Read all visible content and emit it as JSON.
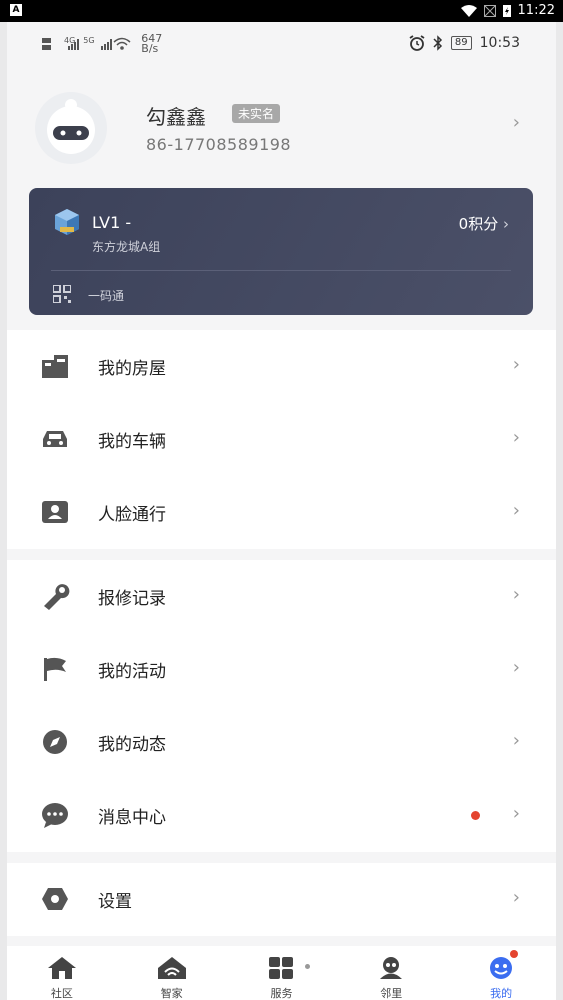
{
  "system_bar": {
    "app_icon_letter": "A",
    "time": "11:22"
  },
  "phone_status": {
    "net_speed": "647",
    "net_unit": "B/s",
    "network_4g": "4G",
    "network_5g": "5G",
    "battery": "89",
    "time": "10:53"
  },
  "profile": {
    "name": "勾鑫鑫",
    "badge": "未实名",
    "phone": "86-17708589198"
  },
  "member_card": {
    "level": "LV1 -",
    "org": "东方龙城A组",
    "points": "0积分",
    "qr_label": "一码通"
  },
  "menu_group1": [
    {
      "icon": "building-icon",
      "label": "我的房屋"
    },
    {
      "icon": "car-icon",
      "label": "我的车辆"
    },
    {
      "icon": "face-id-icon",
      "label": "人脸通行"
    }
  ],
  "menu_group2": [
    {
      "icon": "wrench-icon",
      "label": "报修记录"
    },
    {
      "icon": "flag-icon",
      "label": "我的活动"
    },
    {
      "icon": "compass-icon",
      "label": "我的动态"
    },
    {
      "icon": "chat-icon",
      "label": "消息中心"
    }
  ],
  "menu_group3": [
    {
      "icon": "settings-icon",
      "label": "设置"
    }
  ],
  "tabs": [
    {
      "icon": "home-icon",
      "label": "社区"
    },
    {
      "icon": "smart-home-icon",
      "label": "智家"
    },
    {
      "icon": "services-grid-icon",
      "label": "服务"
    },
    {
      "icon": "neighbor-icon",
      "label": "邻里"
    },
    {
      "icon": "smiley-icon",
      "label": "我的"
    }
  ],
  "colors": {
    "accent": "#3b6df0",
    "notification": "#e4442f",
    "card": "#434861"
  }
}
